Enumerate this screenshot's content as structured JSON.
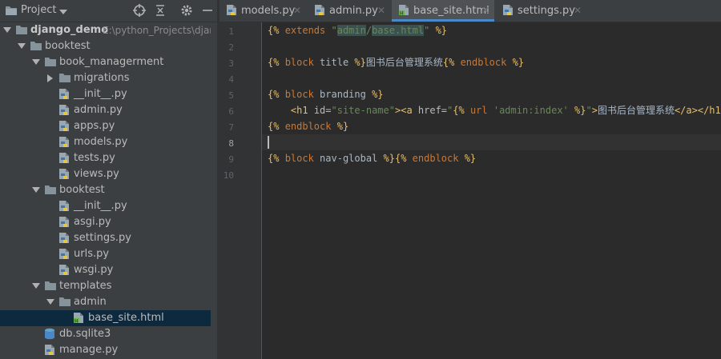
{
  "project_panel": {
    "title": "Project",
    "tree": [
      {
        "label": "django_demo",
        "path": "E:\\python_Projects\\djang",
        "kind": "root",
        "depth": 0,
        "expanded": true,
        "bold": true
      },
      {
        "label": "booktest",
        "kind": "folder",
        "depth": 1,
        "expanded": true
      },
      {
        "label": "book_managerment",
        "kind": "folder",
        "depth": 2,
        "expanded": true
      },
      {
        "label": "migrations",
        "kind": "folder",
        "depth": 3,
        "expanded": false
      },
      {
        "label": "__init__.py",
        "kind": "py",
        "depth": 3
      },
      {
        "label": "admin.py",
        "kind": "py",
        "depth": 3
      },
      {
        "label": "apps.py",
        "kind": "py",
        "depth": 3
      },
      {
        "label": "models.py",
        "kind": "py",
        "depth": 3
      },
      {
        "label": "tests.py",
        "kind": "py",
        "depth": 3
      },
      {
        "label": "views.py",
        "kind": "py",
        "depth": 3
      },
      {
        "label": "booktest",
        "kind": "folder",
        "depth": 2,
        "expanded": true
      },
      {
        "label": "__init__.py",
        "kind": "py",
        "depth": 3
      },
      {
        "label": "asgi.py",
        "kind": "py",
        "depth": 3
      },
      {
        "label": "settings.py",
        "kind": "py",
        "depth": 3
      },
      {
        "label": "urls.py",
        "kind": "py",
        "depth": 3
      },
      {
        "label": "wsgi.py",
        "kind": "py",
        "depth": 3
      },
      {
        "label": "templates",
        "kind": "folder",
        "depth": 2,
        "expanded": true
      },
      {
        "label": "admin",
        "kind": "folder",
        "depth": 3,
        "expanded": true
      },
      {
        "label": "base_site.html",
        "kind": "html",
        "depth": 4,
        "selected": true
      },
      {
        "label": "db.sqlite3",
        "kind": "db",
        "depth": 2
      },
      {
        "label": "manage.py",
        "kind": "py",
        "depth": 2
      }
    ]
  },
  "tabs": [
    {
      "label": "models.py",
      "kind": "py",
      "active": false
    },
    {
      "label": "admin.py",
      "kind": "py",
      "active": false
    },
    {
      "label": "base_site.html",
      "kind": "html",
      "active": true
    },
    {
      "label": "settings.py",
      "kind": "py",
      "active": false
    }
  ],
  "editor": {
    "line_numbers": [
      "1",
      "2",
      "3",
      "4",
      "5",
      "6",
      "7",
      "8",
      "9",
      "10"
    ],
    "current_line": 8,
    "lines": [
      [
        {
          "t": "{% ",
          "c": "tag"
        },
        {
          "t": "extends ",
          "c": "kw"
        },
        {
          "t": "\"",
          "c": "str"
        },
        {
          "t": "admin",
          "c": "ref"
        },
        {
          "t": "/",
          "c": "str"
        },
        {
          "t": "base.html",
          "c": "ref"
        },
        {
          "t": "\"",
          "c": "str"
        },
        {
          "t": " %}",
          "c": "tag"
        }
      ],
      [],
      [
        {
          "t": "{% ",
          "c": "tag"
        },
        {
          "t": "block ",
          "c": "kw"
        },
        {
          "t": "title ",
          "c": "plain"
        },
        {
          "t": "%}",
          "c": "tag"
        },
        {
          "t": "图书后台管理系统",
          "c": "text"
        },
        {
          "t": "{% ",
          "c": "tag"
        },
        {
          "t": "endblock ",
          "c": "kw"
        },
        {
          "t": "%}",
          "c": "tag"
        }
      ],
      [],
      [
        {
          "t": "{% ",
          "c": "tag"
        },
        {
          "t": "block ",
          "c": "kw"
        },
        {
          "t": "branding ",
          "c": "plain"
        },
        {
          "t": "%}",
          "c": "tag"
        }
      ],
      [
        {
          "t": "    ",
          "c": "plain"
        },
        {
          "t": "<h1 ",
          "c": "html"
        },
        {
          "t": "id=",
          "c": "attr"
        },
        {
          "t": "\"site-name\"",
          "c": "str"
        },
        {
          "t": ">",
          "c": "html"
        },
        {
          "t": "<a ",
          "c": "html"
        },
        {
          "t": "href=",
          "c": "attr"
        },
        {
          "t": "\"",
          "c": "str"
        },
        {
          "t": "{% ",
          "c": "tag"
        },
        {
          "t": "url ",
          "c": "kw"
        },
        {
          "t": "'admin:index' ",
          "c": "str"
        },
        {
          "t": "%}",
          "c": "tag"
        },
        {
          "t": "\"",
          "c": "str"
        },
        {
          "t": ">",
          "c": "html"
        },
        {
          "t": "图书后台管理系统",
          "c": "text"
        },
        {
          "t": "</a>",
          "c": "html"
        },
        {
          "t": "</h1>",
          "c": "html"
        }
      ],
      [
        {
          "t": "{% ",
          "c": "tag"
        },
        {
          "t": "endblock ",
          "c": "kw"
        },
        {
          "t": "%}",
          "c": "tag"
        }
      ],
      [],
      [
        {
          "t": "{% ",
          "c": "tag"
        },
        {
          "t": "block ",
          "c": "kw"
        },
        {
          "t": "nav-global ",
          "c": "plain"
        },
        {
          "t": "%}",
          "c": "tag"
        },
        {
          "t": "{% ",
          "c": "tag"
        },
        {
          "t": "endblock ",
          "c": "kw"
        },
        {
          "t": "%}",
          "c": "tag"
        }
      ],
      []
    ]
  },
  "colors": {
    "panel_bg": "#3c3f41",
    "editor_bg": "#2b2b2b",
    "selection": "#0d293e",
    "accent": "#4a88c7"
  }
}
